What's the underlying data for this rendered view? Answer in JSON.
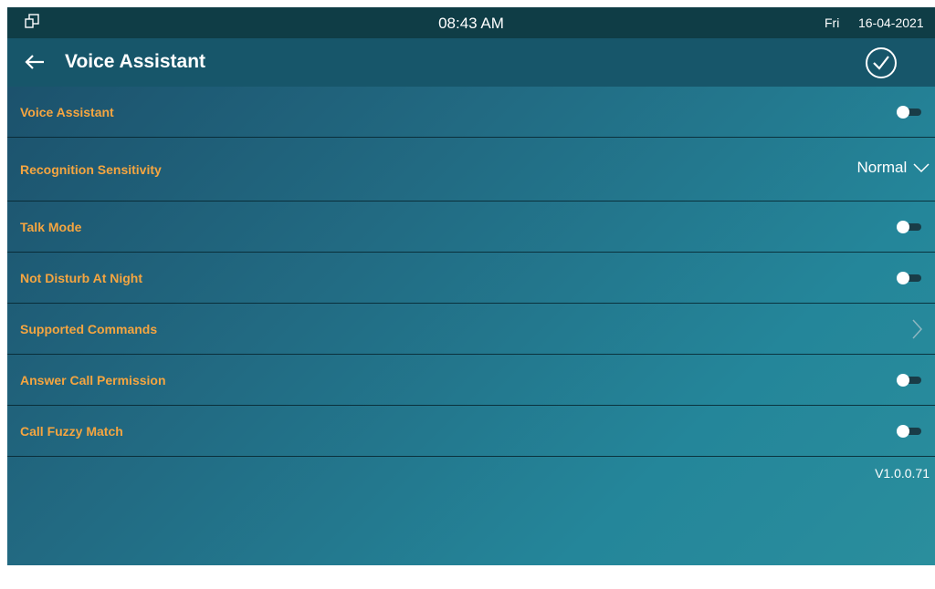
{
  "statusbar": {
    "icon": "window-restore-icon",
    "time": "08:43 AM",
    "day": "Fri",
    "date": "16-04-2021"
  },
  "toolbar": {
    "back_icon": "arrow-left-icon",
    "title": "Voice Assistant",
    "confirm_icon": "check-circle-icon"
  },
  "settings": [
    {
      "label": "Voice Assistant",
      "control": "toggle",
      "on": false
    },
    {
      "label": "Recognition Sensitivity",
      "control": "select",
      "value": "Normal"
    },
    {
      "label": "Talk Mode",
      "control": "toggle",
      "on": false
    },
    {
      "label": "Not Disturb At Night",
      "control": "toggle",
      "on": false
    },
    {
      "label": "Supported Commands",
      "control": "link"
    },
    {
      "label": "Answer Call Permission",
      "control": "toggle",
      "on": false
    },
    {
      "label": "Call Fuzzy Match",
      "control": "toggle",
      "on": false
    }
  ],
  "version": "V1.0.0.71",
  "colors": {
    "label": "#f5a540",
    "statusbar_bg": "#0f3d46",
    "toolbar_bg": "#17566a",
    "divider": "#06242e"
  }
}
